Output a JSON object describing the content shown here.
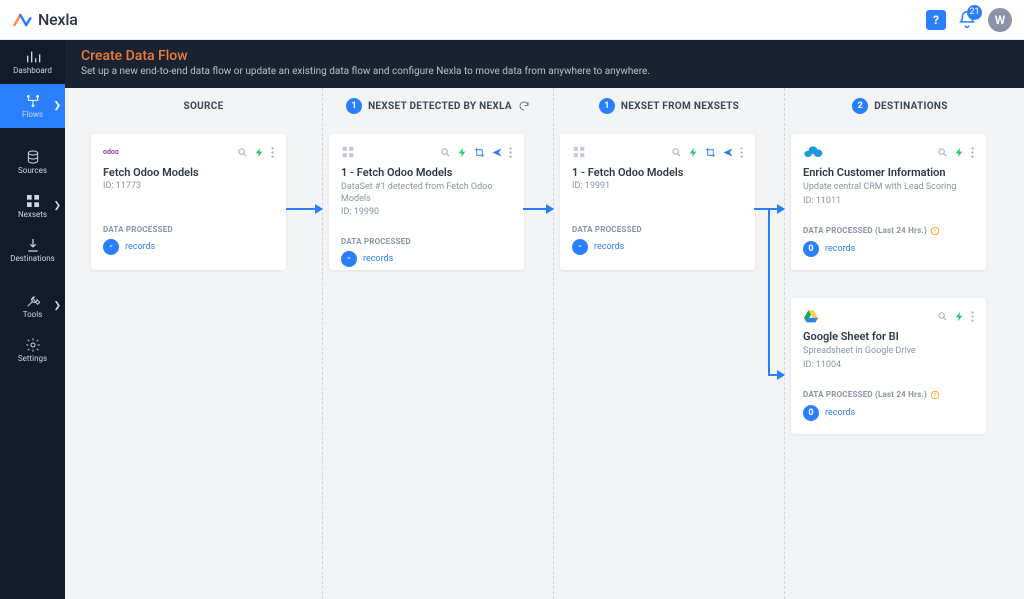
{
  "brand": {
    "name": "Nexla"
  },
  "topbar": {
    "notif_count": "21",
    "avatar_initial": "W",
    "help_label": "?"
  },
  "sidebar": {
    "dashboard": "Dashboard",
    "flows": "Flows",
    "sources": "Sources",
    "nexsets": "Nexsets",
    "destinations": "Destinations",
    "tools": "Tools",
    "settings": "Settings"
  },
  "page": {
    "title": "Create Data Flow",
    "subtitle": "Set up a new end-to-end data flow or update an existing data flow and configure Nexla to move data from anywhere to anywhere."
  },
  "columns": {
    "source": {
      "title": "SOURCE"
    },
    "detected": {
      "title": "NEXSET DETECTED BY NEXLA",
      "count": "1"
    },
    "nexsets": {
      "title": "NEXSET FROM NEXSETS",
      "count": "1"
    },
    "destinations": {
      "title": "DESTINATIONS",
      "count": "2"
    }
  },
  "cards": {
    "source": {
      "connector": "odoo",
      "title": "Fetch Odoo Models",
      "id_label": "ID: 11773",
      "footer_label": "DATA PROCESSED",
      "metric_value": "-",
      "metric_text": "records"
    },
    "detected": {
      "title": "1 - Fetch Odoo Models",
      "subtitle": "DataSet #1 detected from Fetch Odoo Models",
      "id_label": "ID: 19990",
      "footer_label": "DATA PROCESSED",
      "metric_value": "-",
      "metric_text": "records"
    },
    "nexsets": {
      "title": "1 - Fetch Odoo Models",
      "id_label": "ID: 19991",
      "footer_label": "DATA PROCESSED",
      "metric_value": "-",
      "metric_text": "records"
    },
    "dest1": {
      "title": "Enrich Customer Information",
      "subtitle": "Update central CRM with Lead Scoring",
      "id_label": "ID: 11011",
      "footer_label": "DATA PROCESSED (Last 24 Hrs.)",
      "metric_value": "0",
      "metric_text": "records"
    },
    "dest2": {
      "title": "Google Sheet for BI",
      "subtitle": "Spreadsheet in Google Drive",
      "id_label": "ID: 11004",
      "footer_label": "DATA PROCESSED (Last 24 Hrs.)",
      "metric_value": "0",
      "metric_text": "records"
    }
  }
}
